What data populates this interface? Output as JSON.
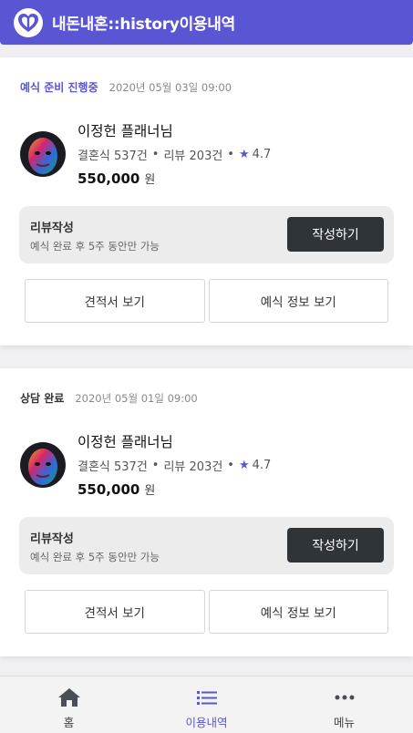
{
  "header": {
    "title": "내돈내혼::history이용내역",
    "colors": {
      "primary": "#5a55d2"
    },
    "logo_icon": "heart-logo-icon"
  },
  "history": [
    {
      "status": "예식 준비 진행중",
      "status_color": "#5a55d2",
      "date": "2020년 05월 03일 09:00",
      "planner": {
        "name": "이정헌 플래너님",
        "weddings": "결혼식 537건",
        "reviews": "리뷰 203건",
        "rating": "4.7",
        "price": "550,000",
        "price_unit": "원"
      },
      "review": {
        "title": "리뷰작성",
        "desc": "예식 완료 후 5주 동안만 가능",
        "button": "작성하기"
      },
      "buttons": {
        "estimate": "견적서 보기",
        "wedding_info": "예식 정보 보기"
      }
    },
    {
      "status": "상담 완료",
      "status_color": "#333333",
      "date": "2020년 05월 01일 09:00",
      "planner": {
        "name": "이정헌 플래너님",
        "weddings": "결혼식 537건",
        "reviews": "리뷰 203건",
        "rating": "4.7",
        "price": "550,000",
        "price_unit": "원"
      },
      "review": {
        "title": "리뷰작성",
        "desc": "예식 완료 후 5주 동안만 가능",
        "button": "작성하기"
      },
      "buttons": {
        "estimate": "견적서 보기",
        "wedding_info": "예식 정보 보기"
      }
    }
  ],
  "nav": {
    "items": [
      {
        "label": "홈",
        "icon": "home-icon",
        "active": false
      },
      {
        "label": "이용내역",
        "icon": "list-icon",
        "active": true
      },
      {
        "label": "메뉴",
        "icon": "more-icon",
        "active": false
      }
    ]
  }
}
